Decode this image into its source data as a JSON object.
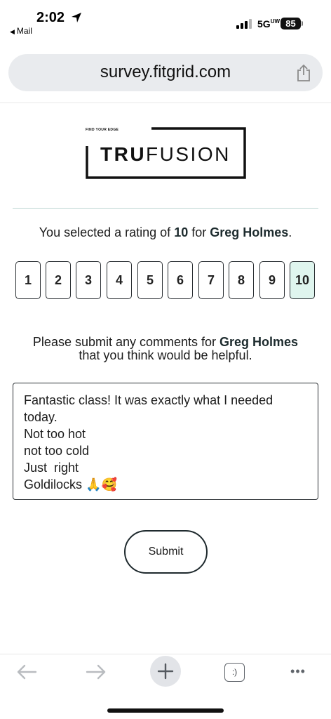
{
  "status_bar": {
    "time": "2:02",
    "back_app": "Mail",
    "network": "5G",
    "network_sup": "UW",
    "battery": "85",
    "icons": [
      "location-arrow-icon",
      "cellular-signal-icon",
      "battery-icon"
    ]
  },
  "browser": {
    "url": "survey.fitgrid.com",
    "share_icon": "share-icon"
  },
  "logo": {
    "tagline": "FIND YOUR EDGE",
    "brand_bold": "TRU",
    "brand_light": "FUSION"
  },
  "selection": {
    "prefix": "You selected a rating of ",
    "rating": "10",
    "middle": " for ",
    "instructor": "Greg Holmes",
    "suffix": "."
  },
  "ratings": {
    "options": [
      "1",
      "2",
      "3",
      "4",
      "5",
      "6",
      "7",
      "8",
      "9",
      "10"
    ],
    "selected": "10",
    "selected_color": "#dff5ee"
  },
  "prompt": {
    "prefix": "Please submit any comments for ",
    "instructor": "Greg Holmes",
    "line2": "that you think would be helpful."
  },
  "comment": {
    "lines": [
      "Fantastic class! It was exactly what I needed",
      "today.",
      "Not too hot",
      "not too cold",
      "Just  right",
      "Goldilocks 🙏🥰"
    ]
  },
  "submit": {
    "label": "Submit"
  },
  "toolbar": {
    "icons": [
      "back-arrow-icon",
      "forward-arrow-icon",
      "plus-icon",
      "tabs-icon",
      "more-icon"
    ],
    "tabs_label": ":)",
    "more_label": "•••"
  }
}
